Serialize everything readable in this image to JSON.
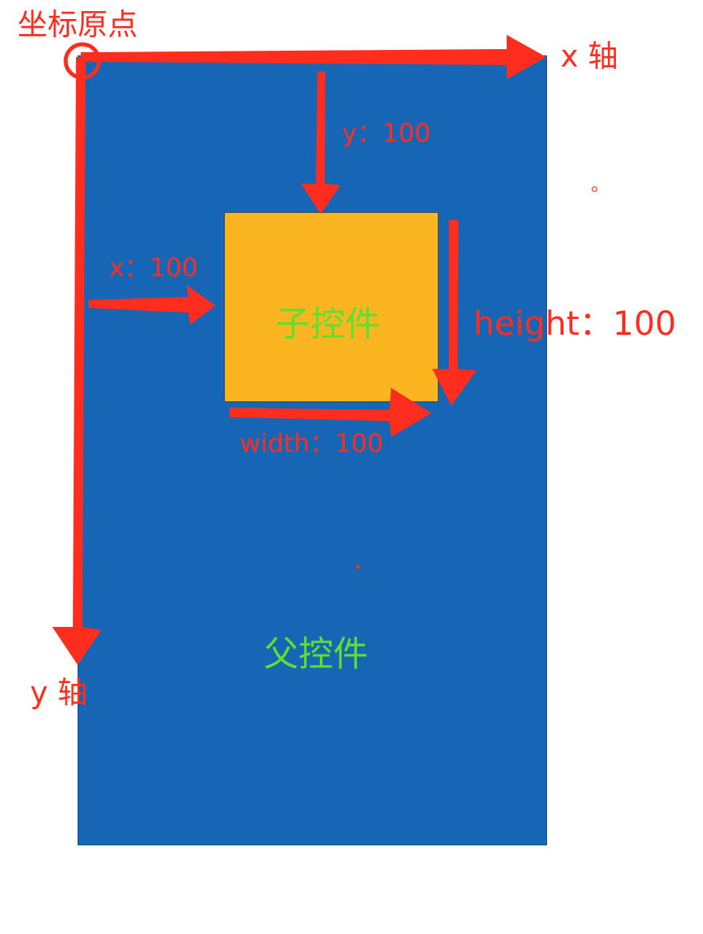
{
  "labels": {
    "origin": "坐标原点",
    "x_axis": "x 轴",
    "y_axis": "y 轴",
    "y_offset": "y：100",
    "x_offset": "x：100",
    "height": "height：100",
    "width": "width：100",
    "child_view": "子控件",
    "parent_view": "父控件"
  },
  "colors": {
    "parent_fill": "#1766b5",
    "child_fill": "#fbb521",
    "annotation_red": "#ff2d1e",
    "view_label_green": "#5de02f"
  }
}
